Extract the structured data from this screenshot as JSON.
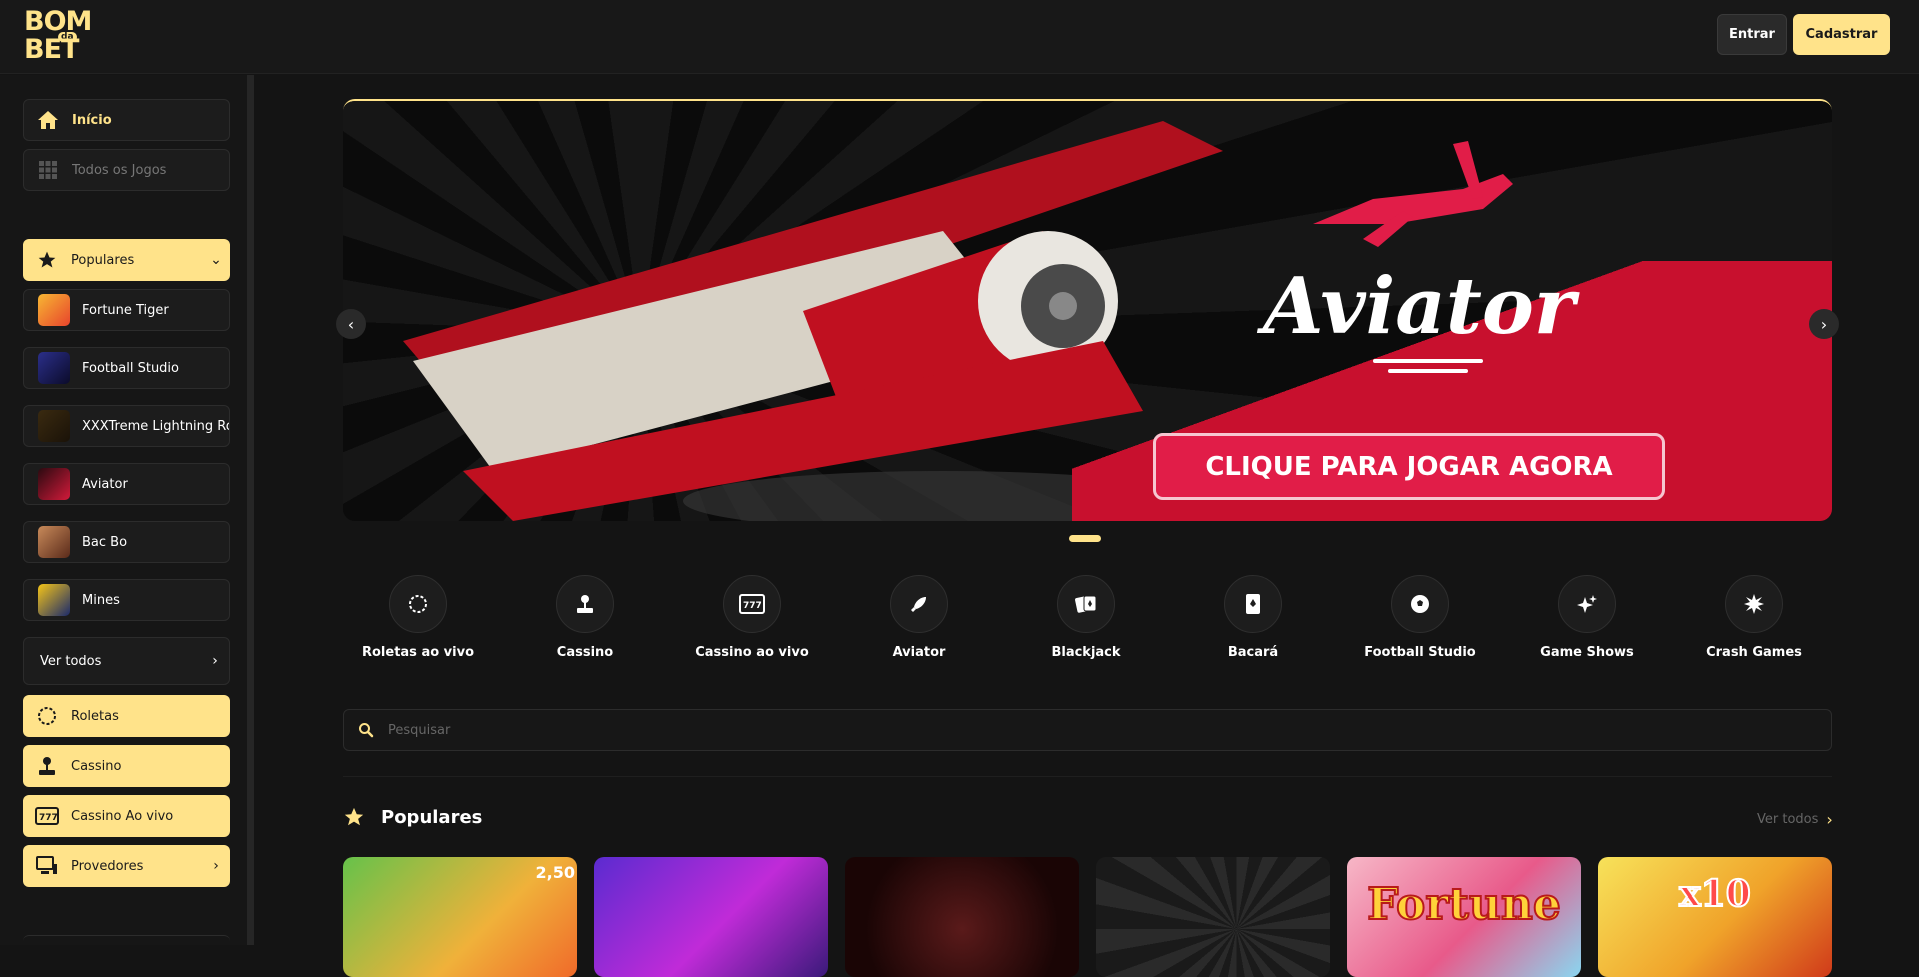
{
  "header": {
    "logo_line1": "BOM",
    "logo_line2": "BET",
    "logo_da": "da",
    "login_label": "Entrar",
    "signup_label": "Cadastrar"
  },
  "sidebar": {
    "home_label": "Início",
    "all_games_label": "Todos os Jogos",
    "popular_label": "Populares",
    "games": [
      {
        "label": "Fortune Tiger"
      },
      {
        "label": "Football Studio"
      },
      {
        "label": "XXXTreme Lightning Ro"
      },
      {
        "label": "Aviator"
      },
      {
        "label": "Bac Bo"
      },
      {
        "label": "Mines"
      }
    ],
    "see_all_label": "Ver todos",
    "sections": [
      {
        "label": "Roletas"
      },
      {
        "label": "Cassino"
      },
      {
        "label": "Cassino Ao vivo"
      },
      {
        "label": "Provedores"
      }
    ]
  },
  "banner": {
    "brand": "Aviator",
    "cta": "CLIQUE PARA JOGAR AGORA"
  },
  "categories": [
    {
      "label": "Roletas ao vivo",
      "icon": "roulette-icon"
    },
    {
      "label": "Cassino",
      "icon": "joystick-icon"
    },
    {
      "label": "Cassino ao vivo",
      "icon": "slot-777-icon"
    },
    {
      "label": "Aviator",
      "icon": "rocket-icon"
    },
    {
      "label": "Blackjack",
      "icon": "cards-icon"
    },
    {
      "label": "Bacará",
      "icon": "card-spade-icon"
    },
    {
      "label": "Football Studio",
      "icon": "soccer-ball-icon"
    },
    {
      "label": "Game Shows",
      "icon": "sparkle-icon"
    },
    {
      "label": "Crash Games",
      "icon": "burst-icon"
    }
  ],
  "search": {
    "placeholder": "Pesquisar"
  },
  "popular_section": {
    "title": "Populares",
    "see_all": "Ver todos",
    "cards": [
      {
        "text": "2,50"
      },
      {
        "text": ""
      },
      {
        "text": ""
      },
      {
        "text": ""
      },
      {
        "text": "Fortune"
      },
      {
        "text": "x10"
      }
    ]
  },
  "colors": {
    "accent": "#ffe38a",
    "cta_red": "#e11d48",
    "bg": "#141414"
  }
}
